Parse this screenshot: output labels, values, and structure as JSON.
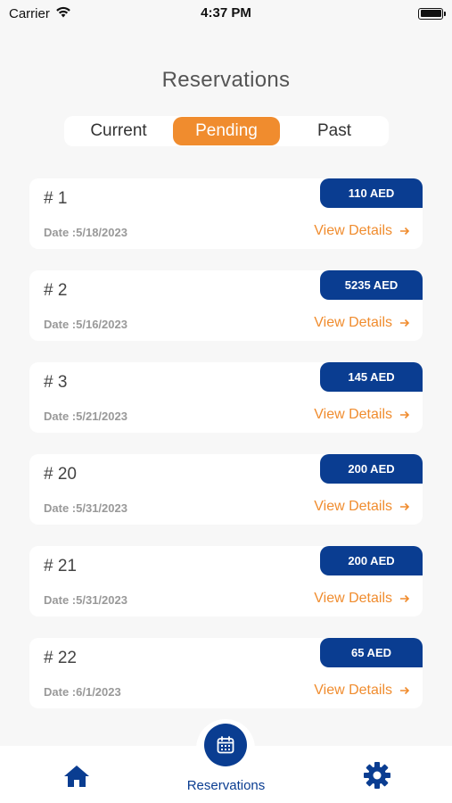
{
  "status_bar": {
    "carrier": "Carrier",
    "time": "4:37 PM"
  },
  "header": {
    "title": "Reservations"
  },
  "tabs": [
    {
      "label": "Current",
      "active": false
    },
    {
      "label": "Pending",
      "active": true
    },
    {
      "label": "Past",
      "active": false
    }
  ],
  "reservations": [
    {
      "number": "# 1",
      "date": "Date :5/18/2023",
      "price": "110 AED",
      "link": "View Details"
    },
    {
      "number": "# 2",
      "date": "Date :5/16/2023",
      "price": "5235 AED",
      "link": "View Details"
    },
    {
      "number": "# 3",
      "date": "Date :5/21/2023",
      "price": "145 AED",
      "link": "View Details"
    },
    {
      "number": "# 20",
      "date": "Date :5/31/2023",
      "price": "200 AED",
      "link": "View Details"
    },
    {
      "number": "# 21",
      "date": "Date :5/31/2023",
      "price": "200 AED",
      "link": "View Details"
    },
    {
      "number": "# 22",
      "date": "Date :6/1/2023",
      "price": "65 AED",
      "link": "View Details"
    }
  ],
  "bottom_nav": {
    "items": [
      {
        "icon": "home-icon"
      },
      {
        "icon": "calendar-icon",
        "label": "Reservations"
      },
      {
        "icon": "gear-icon"
      }
    ]
  },
  "colors": {
    "accent": "#f08c2e",
    "brand": "#0a3d91",
    "background": "#f7f7f7"
  }
}
